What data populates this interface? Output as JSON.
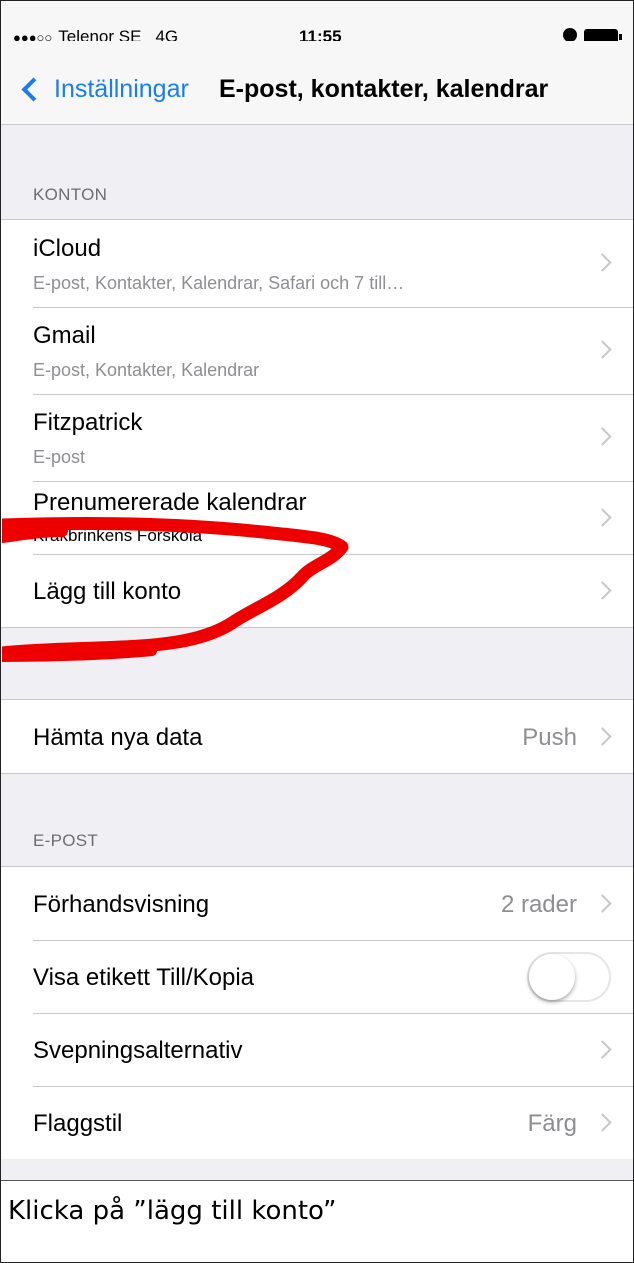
{
  "status_bar": {
    "signal": "●●●○○",
    "carrier": "Telenor SE",
    "network": "4G",
    "time": "11:55",
    "alarm_icon": "alarm-clock-icon",
    "battery_icon": "battery-icon"
  },
  "nav": {
    "back_label": "Inställningar",
    "title": "E-post, kontakter, kalendrar",
    "accent_color": "#1a7cf0"
  },
  "sections": {
    "accounts_header": "KONTON",
    "mail_header": "E-POST"
  },
  "accounts": [
    {
      "title": "iCloud",
      "subtitle": "E-post, Kontakter, Kalendrar, Safari och 7 till…"
    },
    {
      "title": "Gmail",
      "subtitle": "E-post, Kontakter, Kalendrar"
    },
    {
      "title": "Fitzpatrick",
      "subtitle": "E-post"
    },
    {
      "title": "Prenumererade kalendrar",
      "subtitle": "Kråkbrinkens Förskola"
    }
  ],
  "add_account": {
    "title": "Lägg till konto"
  },
  "fetch": {
    "title": "Hämta nya data",
    "value": "Push"
  },
  "mail_rows": {
    "preview": {
      "title": "Förhandsvisning",
      "value": "2 rader"
    },
    "show_to_cc": {
      "title": "Visa etikett Till/Kopia",
      "toggle_on": false
    },
    "swipe": {
      "title": "Svepningsalternativ"
    },
    "flag": {
      "title": "Flaggstil",
      "value": "Färg"
    }
  },
  "annotation": {
    "color": "#ee0000"
  },
  "caption": "Klicka på ”lägg till konto”"
}
